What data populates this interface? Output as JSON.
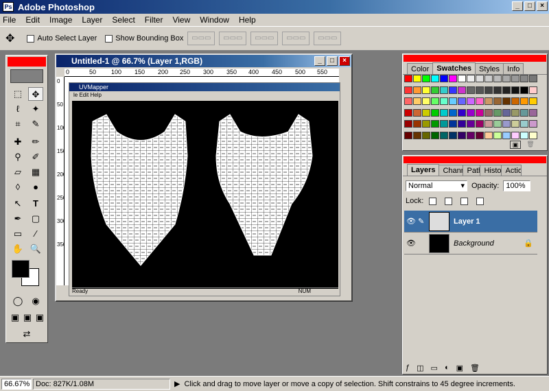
{
  "app": {
    "title": "Adobe Photoshop"
  },
  "menu": [
    "File",
    "Edit",
    "Image",
    "Layer",
    "Select",
    "Filter",
    "View",
    "Window",
    "Help"
  ],
  "options": {
    "auto_select": "Auto Select Layer",
    "show_bbox": "Show Bounding Box"
  },
  "document": {
    "title": "Untitled-1 @ 66.7% (Layer 1,RGB)",
    "ruler_h": [
      "0",
      "50",
      "100",
      "150",
      "200",
      "250",
      "300",
      "350",
      "400",
      "450",
      "500",
      "550"
    ],
    "ruler_v": [
      "0",
      "50",
      "100",
      "150",
      "200",
      "250",
      "300",
      "350"
    ]
  },
  "uvmapper": {
    "title": "UVMapper",
    "menu": "le  Edit  Help",
    "status": "Ready",
    "status_right": "NUM"
  },
  "swatches": {
    "tabs": [
      "Color",
      "Swatches",
      "Styles",
      "Info"
    ],
    "colors": [
      "#ff0000",
      "#ffff00",
      "#00ff00",
      "#00ffff",
      "#0000ff",
      "#ff00ff",
      "#ffffff",
      "#eeeeee",
      "#dddddd",
      "#cccccc",
      "#bbbbbb",
      "#aaaaaa",
      "#999999",
      "#888888",
      "#777777",
      "#ff3333",
      "#ff9933",
      "#ffff33",
      "#33cc33",
      "#33cccc",
      "#3333ff",
      "#cc33cc",
      "#666666",
      "#555555",
      "#444444",
      "#333333",
      "#222222",
      "#111111",
      "#000000",
      "#ffcccc",
      "#ff6666",
      "#ffcc66",
      "#ffff66",
      "#66ff66",
      "#66ffcc",
      "#66ccff",
      "#6666ff",
      "#cc66ff",
      "#ff66cc",
      "#cc9966",
      "#996633",
      "#663300",
      "#cc6600",
      "#ff9900",
      "#ffcc00",
      "#cc0000",
      "#cc6633",
      "#cccc00",
      "#00cc00",
      "#00cccc",
      "#0066cc",
      "#3300cc",
      "#9900cc",
      "#cc0099",
      "#996666",
      "#669966",
      "#666699",
      "#999966",
      "#669999",
      "#996699",
      "#990000",
      "#993300",
      "#999900",
      "#009900",
      "#009999",
      "#003399",
      "#330099",
      "#660099",
      "#990066",
      "#cc9999",
      "#99cc99",
      "#9999cc",
      "#cccc99",
      "#99cccc",
      "#cc99cc",
      "#660000",
      "#663300",
      "#666600",
      "#006600",
      "#006666",
      "#003366",
      "#330066",
      "#660066",
      "#660033",
      "#ffcc99",
      "#ccff99",
      "#99ccff",
      "#ffccff",
      "#ccffff",
      "#ffffcc"
    ]
  },
  "layers": {
    "tabs": [
      "Layers",
      "Channels",
      "Paths",
      "History",
      "Actions"
    ],
    "blend": "Normal",
    "opacity_label": "Opacity:",
    "opacity": "100%",
    "lock_label": "Lock:",
    "items": [
      {
        "name": "Layer 1",
        "selected": true
      },
      {
        "name": "Background",
        "selected": false
      }
    ]
  },
  "status": {
    "zoom": "66.67%",
    "doc": "Doc: 827K/1.08M",
    "hint": "Click and drag to move layer or move a copy of selection. Shift constrains to 45 degree increments."
  }
}
